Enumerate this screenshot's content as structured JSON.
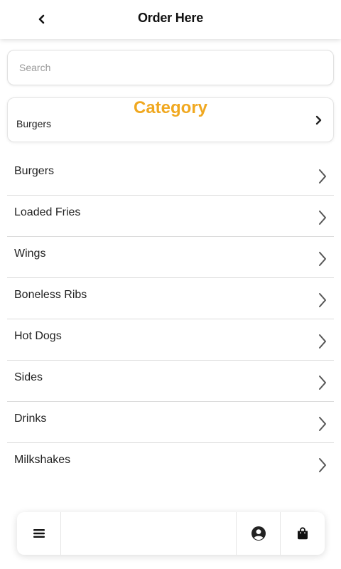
{
  "header": {
    "title": "Order Here",
    "back_icon": "chevron-left-icon"
  },
  "search": {
    "placeholder": "Search",
    "value": ""
  },
  "category": {
    "heading": "Category",
    "selected": "Burgers",
    "accent_color": "#f0a820",
    "icon": "chevron-right-icon"
  },
  "menu": {
    "items": [
      {
        "label": "Burgers"
      },
      {
        "label": "Loaded Fries"
      },
      {
        "label": "Wings"
      },
      {
        "label": "Boneless Ribs"
      },
      {
        "label": "Hot Dogs"
      },
      {
        "label": "Sides"
      },
      {
        "label": "Drinks"
      },
      {
        "label": "Milkshakes"
      }
    ]
  },
  "bottom_nav": {
    "menu_icon": "hamburger-menu-icon",
    "account_icon": "user-circle-icon",
    "bag_icon": "shopping-bag-icon"
  }
}
